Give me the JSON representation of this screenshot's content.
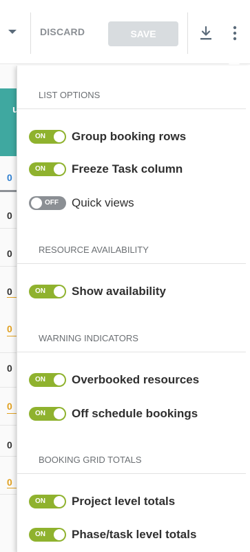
{
  "toolbar": {
    "discard_label": "DISCARD",
    "save_label": "SAVE",
    "download_icon": "download-icon",
    "more_icon": "kebab-vertical-icon"
  },
  "background": {
    "header_fragment": "u",
    "row_fragments": [
      "0",
      "0",
      "0",
      "0",
      "0",
      "0",
      "0",
      "0",
      "0"
    ]
  },
  "sections": [
    {
      "title": "LIST OPTIONS",
      "items": [
        {
          "label": "Group booking rows",
          "state": "ON",
          "on": true
        },
        {
          "label": "Freeze Task column",
          "state": "ON",
          "on": true
        },
        {
          "label": "Quick views",
          "state": "OFF",
          "on": false
        }
      ]
    },
    {
      "title": "RESOURCE AVAILABILITY",
      "items": [
        {
          "label": "Show availability",
          "state": "ON",
          "on": true
        }
      ]
    },
    {
      "title": "WARNING INDICATORS",
      "items": [
        {
          "label": "Overbooked resources",
          "state": "ON",
          "on": true
        },
        {
          "label": "Off schedule bookings",
          "state": "ON",
          "on": true
        }
      ]
    },
    {
      "title": "BOOKING GRID TOTALS",
      "items": [
        {
          "label": "Project level totals",
          "state": "ON",
          "on": true
        },
        {
          "label": "Phase/task level totals",
          "state": "ON",
          "on": true
        }
      ]
    }
  ],
  "colors": {
    "toggle_on": "#8fb22e",
    "toggle_off": "#8b8f94",
    "accent_teal": "#3fa8a0",
    "blue_value": "#2f7fd0",
    "orange_value": "#e0a020"
  }
}
